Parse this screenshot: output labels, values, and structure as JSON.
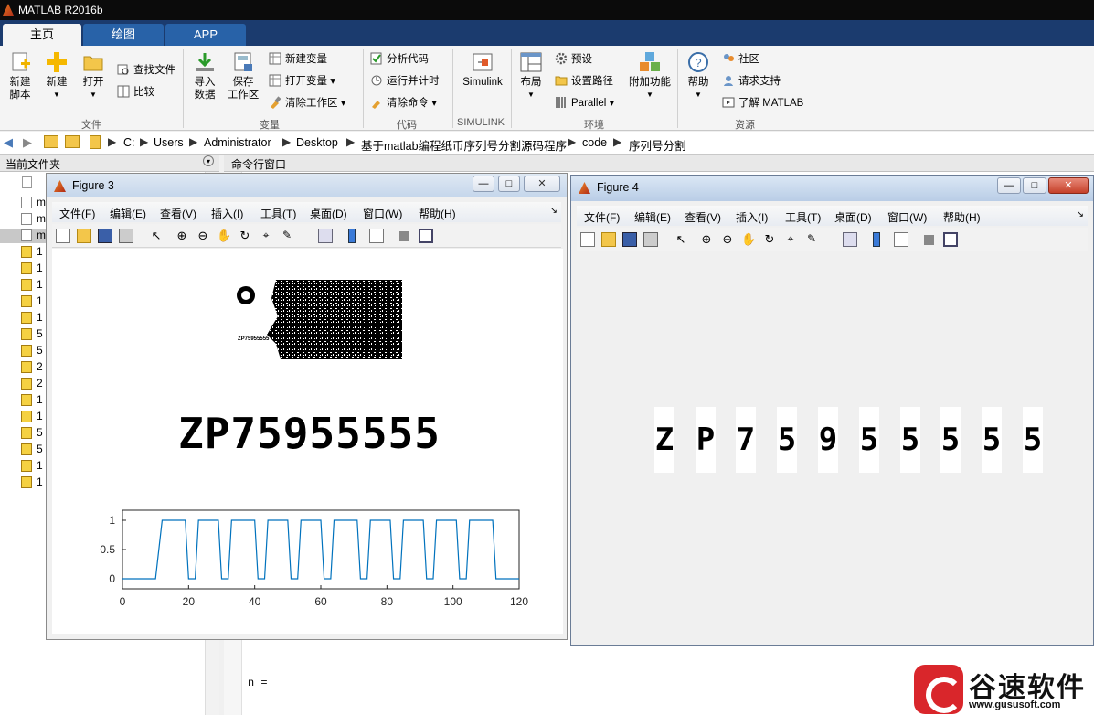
{
  "app": {
    "title": "MATLAB R2016b"
  },
  "tabs": [
    {
      "label": "主页"
    },
    {
      "label": "绘图"
    },
    {
      "label": "APP"
    }
  ],
  "ribbon": {
    "file": {
      "new_script": "新建\n脚本",
      "new": "新建",
      "open": "打开",
      "find_files": "查找文件",
      "compare": "比较",
      "group": "文件"
    },
    "variable": {
      "import": "导入\n数据",
      "save_ws": "保存\n工作区",
      "new_var": "新建变量",
      "open_var": "打开变量",
      "clear_ws": "清除工作区",
      "group": "变量"
    },
    "code": {
      "analyze": "分析代码",
      "run_time": "运行并计时",
      "clear_cmd": "清除命令",
      "group": "代码"
    },
    "simulink": {
      "label": "Simulink",
      "group": "SIMULINK"
    },
    "env": {
      "layout": "布局",
      "prefs": "预设",
      "set_path": "设置路径",
      "parallel": "Parallel",
      "addons": "附加功能",
      "group": "环境"
    },
    "resources": {
      "help": "帮助",
      "community": "社区",
      "support": "请求支持",
      "learn": "了解 MATLAB",
      "group": "资源"
    }
  },
  "address": {
    "crumbs": [
      "C:",
      "Users",
      "Administrator",
      "Desktop",
      "基于matlab编程纸币序列号分割源码程序",
      "code",
      "序列号分割"
    ]
  },
  "panes": {
    "current_folder": "当前文件夹",
    "command_window": "命令行窗口"
  },
  "files": [
    "m",
    "m",
    "m",
    "1",
    "1",
    "1",
    "1",
    "1",
    "5",
    "5",
    "2",
    "2",
    "1",
    "1",
    "5",
    "5",
    "1",
    "1"
  ],
  "command": {
    "output": "n ="
  },
  "figure3": {
    "title": "Figure 3",
    "menu": [
      "文件(F)",
      "编辑(E)",
      "查看(V)",
      "插入(I)",
      "工具(T)",
      "桌面(D)",
      "窗口(W)",
      "帮助(H)"
    ],
    "serial_image_text": "ZP75955555",
    "thumb_text": "ZP75955555"
  },
  "figure4": {
    "title": "Figure 4",
    "menu": [
      "文件(F)",
      "编辑(E)",
      "查看(V)",
      "插入(I)",
      "工具(T)",
      "桌面(D)",
      "窗口(W)",
      "帮助(H)"
    ],
    "chars": [
      "Z",
      "P",
      "7",
      "5",
      "9",
      "5",
      "5",
      "5",
      "5",
      "5"
    ]
  },
  "chart_data": {
    "type": "line",
    "title": "",
    "xlabel": "",
    "ylabel": "",
    "xlim": [
      0,
      120
    ],
    "ylim": [
      0,
      1
    ],
    "xticks": [
      0,
      20,
      40,
      60,
      80,
      100,
      120
    ],
    "yticks": [
      0,
      0.5,
      1
    ],
    "x": [
      0,
      10,
      12,
      19,
      20,
      22,
      23,
      29,
      30,
      32,
      33,
      40,
      41,
      43,
      44,
      50,
      51,
      53,
      54,
      60,
      61,
      63,
      64,
      71,
      72,
      74,
      75,
      81,
      82,
      84,
      85,
      91,
      92,
      94,
      95,
      101,
      102,
      104,
      105,
      112,
      113,
      120
    ],
    "series": [
      {
        "values": [
          0,
          0,
          1,
          1,
          0,
          0,
          1,
          1,
          0,
          0,
          1,
          1,
          0,
          0,
          1,
          1,
          0,
          0,
          1,
          1,
          0,
          0,
          1,
          1,
          0,
          0,
          1,
          1,
          0,
          0,
          1,
          1,
          0,
          0,
          1,
          1,
          0,
          0,
          1,
          1,
          0,
          0
        ],
        "color": "#0072bd"
      }
    ]
  },
  "watermark": {
    "brand": "谷速软件",
    "url": "www.gususoft.com"
  }
}
